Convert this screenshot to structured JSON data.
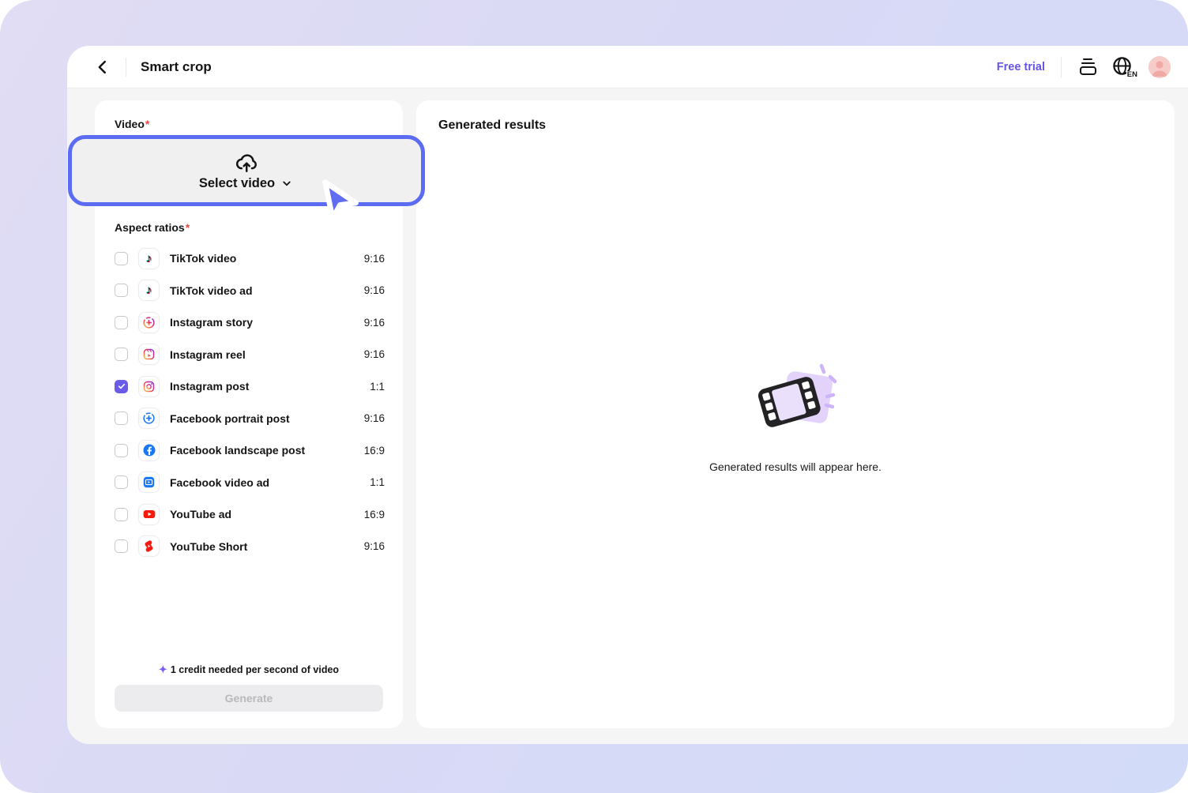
{
  "header": {
    "title": "Smart crop",
    "free_trial_label": "Free trial",
    "language_code": "EN"
  },
  "left_panel": {
    "video_label": "Video",
    "required_marker": "*",
    "select_video_label": "Select video",
    "aspect_ratios_label": "Aspect ratios",
    "ratios": [
      {
        "label": "TikTok video",
        "ratio": "9:16",
        "icon": "tiktok-icon",
        "checked": false
      },
      {
        "label": "TikTok video ad",
        "ratio": "9:16",
        "icon": "tiktok-icon",
        "checked": false
      },
      {
        "label": "Instagram story",
        "ratio": "9:16",
        "icon": "instagram-story-icon",
        "checked": false
      },
      {
        "label": "Instagram reel",
        "ratio": "9:16",
        "icon": "instagram-reel-icon",
        "checked": false
      },
      {
        "label": "Instagram post",
        "ratio": "1:1",
        "icon": "instagram-post-icon",
        "checked": true
      },
      {
        "label": "Facebook portrait post",
        "ratio": "9:16",
        "icon": "facebook-portrait-icon",
        "checked": false
      },
      {
        "label": "Facebook landscape post",
        "ratio": "16:9",
        "icon": "facebook-icon",
        "checked": false
      },
      {
        "label": "Facebook video ad",
        "ratio": "1:1",
        "icon": "facebook-video-icon",
        "checked": false
      },
      {
        "label": "YouTube ad",
        "ratio": "16:9",
        "icon": "youtube-icon",
        "checked": false
      },
      {
        "label": "YouTube Short",
        "ratio": "9:16",
        "icon": "youtube-shorts-icon",
        "checked": false
      }
    ],
    "credit_note": "1 credit needed per second of video",
    "credit_spark": "✦",
    "generate_label": "Generate"
  },
  "right_panel": {
    "title": "Generated results",
    "empty_text": "Generated results will appear here."
  },
  "colors": {
    "accent_purple": "#6a5ce8",
    "free_trial_purple": "#6556e8",
    "highlight_blue": "#5b6cf2",
    "cursor_blue": "#5f6df0",
    "help_fab_purple": "#6b4ee6",
    "facebook_blue": "#1877f2",
    "youtube_red": "#f61c0d",
    "tiktok_red": "#fe2c55",
    "tiktok_cyan": "#25f4ee",
    "background_lavender": "#d9d9f5",
    "content_gray": "#f5f5f6",
    "required_red": "#f4493e"
  }
}
